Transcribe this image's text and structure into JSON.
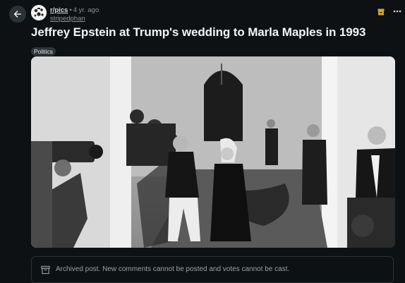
{
  "post": {
    "subreddit": "r/pics",
    "separator": "•",
    "age": "4 yr. ago",
    "author": "stripedphan",
    "title": "Jeffrey Epstein at Trump's wedding to Marla Maples in 1993",
    "flair": "Politics"
  },
  "notice": {
    "text": "Archived post. New comments cannot be posted and votes cannot be cast."
  },
  "icons": {
    "back": "arrow-left-icon",
    "archive": "archive-icon",
    "more": "more-horizontal-icon",
    "notice": "archive-box-icon"
  },
  "colors": {
    "background": "#0e1113",
    "archive_badge": "#d4a52a"
  }
}
